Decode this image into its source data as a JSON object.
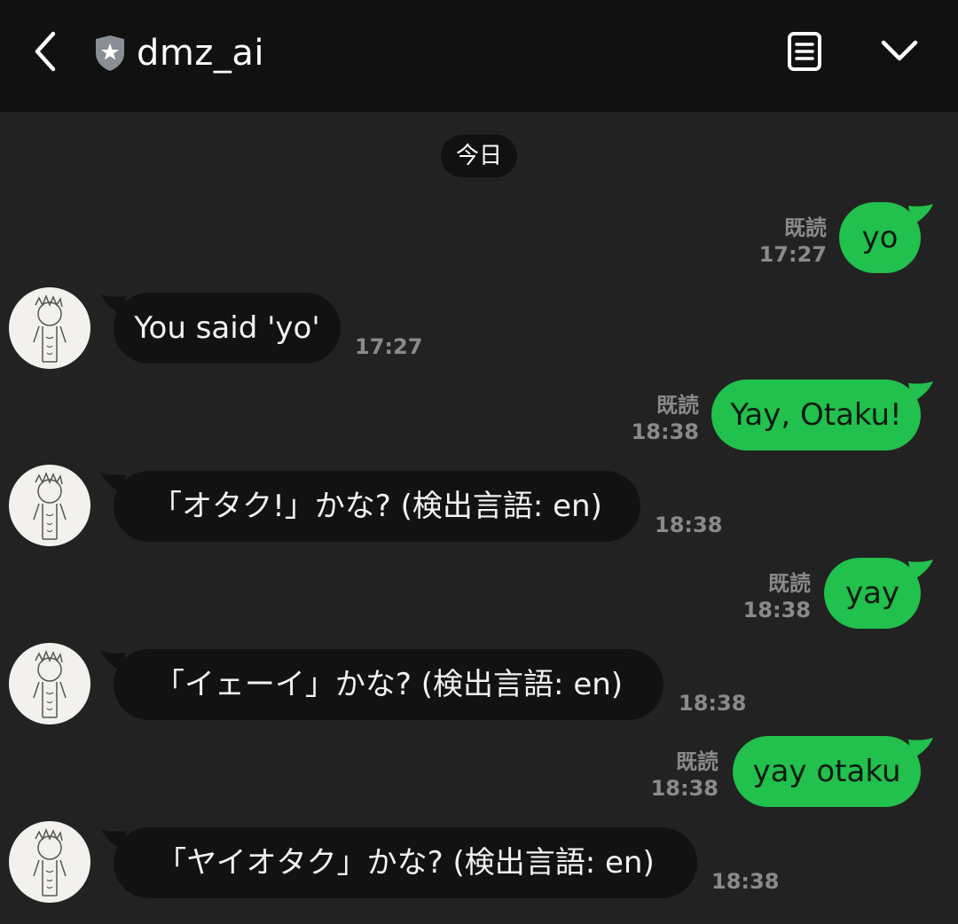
{
  "header": {
    "title": "dmz_ai",
    "icons": {
      "back": "chevron-left-icon",
      "badge": "shield-star-icon",
      "notes": "note-icon",
      "menu": "chevron-down-icon"
    }
  },
  "date_divider": "今日",
  "colors": {
    "outgoing_bubble": "#22c04c",
    "incoming_bubble": "#121212",
    "header_bg": "#111111",
    "chat_bg": "#222222"
  },
  "messages": [
    {
      "dir": "out",
      "text": "yo",
      "read": "既読",
      "time": "17:27"
    },
    {
      "dir": "in",
      "text": "You said 'yo'",
      "time": "17:27"
    },
    {
      "dir": "out",
      "text": "Yay, Otaku!",
      "read": "既読",
      "time": "18:38"
    },
    {
      "dir": "in",
      "text": "「オタク!」かな? (検出言語: en)",
      "time": "18:38"
    },
    {
      "dir": "out",
      "text": "yay",
      "read": "既読",
      "time": "18:38"
    },
    {
      "dir": "in",
      "text": "「イェーイ」かな? (検出言語: en)",
      "time": "18:38"
    },
    {
      "dir": "out",
      "text": "yay otaku",
      "read": "既読",
      "time": "18:38"
    },
    {
      "dir": "in",
      "text": "「ヤイオタク」かな? (検出言語: en)",
      "time": "18:38"
    }
  ]
}
